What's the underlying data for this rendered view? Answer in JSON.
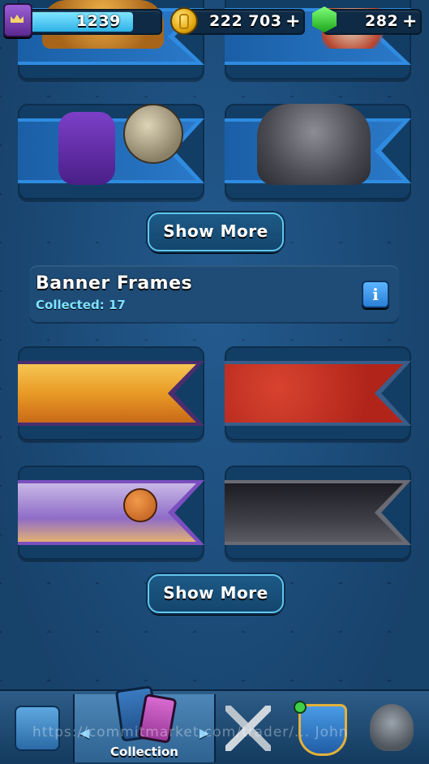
{
  "resources": {
    "level_value": "1239",
    "level_progress": 0.8,
    "gold": "222 703",
    "gems": "282",
    "plus": "+"
  },
  "emote_section": {
    "show_more_label": "Show More",
    "items": [
      {
        "icon": "golden-character-emote"
      },
      {
        "icon": "dragon-emote"
      },
      {
        "icon": "purple-wrestler-emote"
      },
      {
        "icon": "armored-knight-emote"
      }
    ]
  },
  "banner_frames": {
    "title": "Banner Frames",
    "collected_label": "Collected: 17",
    "info_label": "i",
    "show_more_label": "Show More",
    "items": [
      {
        "icon": "orange-wheat-banner",
        "color": "#e89a25"
      },
      {
        "icon": "red-star-banner",
        "color": "#c42a1f"
      },
      {
        "icon": "basketball-court-banner",
        "color": "#7b4fbf"
      },
      {
        "icon": "dark-skeleton-banner",
        "color": "#3d3d45"
      }
    ]
  },
  "bottom_nav": {
    "items": [
      {
        "name": "shop",
        "icon": "treasure-chest-icon",
        "label": ""
      },
      {
        "name": "collection",
        "icon": "cards-icon",
        "label": "Collection"
      },
      {
        "name": "battle",
        "icon": "crossed-swords-icon",
        "label": ""
      },
      {
        "name": "social",
        "icon": "clan-shield-icon",
        "label": ""
      },
      {
        "name": "events",
        "icon": "helmet-badge-icon",
        "label": ""
      }
    ]
  },
  "watermark": "https://commitmarket.com/trader/... John"
}
